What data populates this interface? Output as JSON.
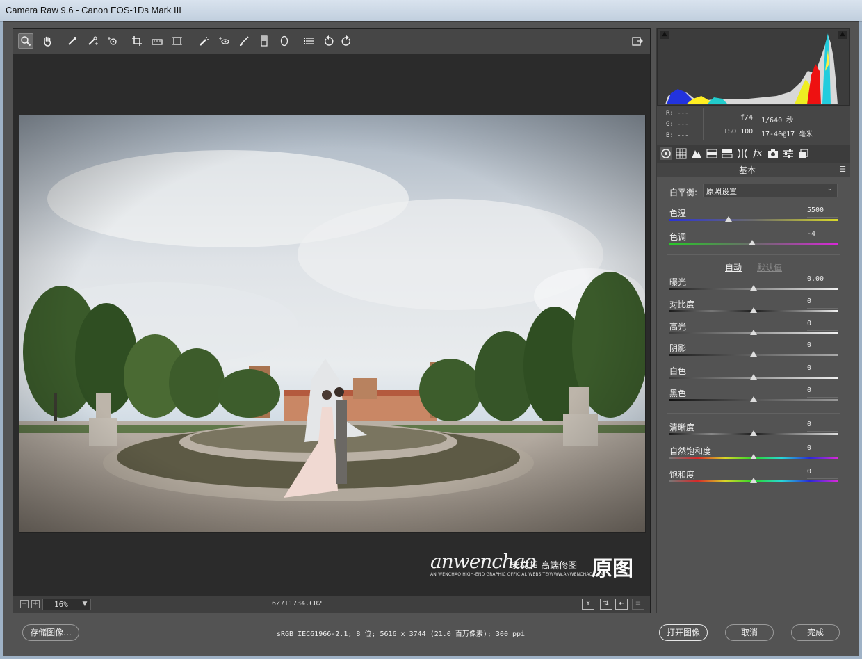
{
  "window": {
    "title": "Camera Raw 9.6 -  Canon EOS-1Ds Mark III"
  },
  "toolbar": {
    "tools": [
      "zoom-tool",
      "hand-tool",
      "white-balance-tool",
      "color-sampler-tool",
      "targeted-adjustment-tool",
      "crop-tool",
      "straighten-tool",
      "transform-tool",
      "spot-removal-tool",
      "red-eye-tool",
      "adjustment-brush",
      "graduated-filter",
      "radial-filter",
      "preferences",
      "rotate-ccw",
      "rotate-cw"
    ],
    "active_tool": "zoom-tool"
  },
  "histogram": {
    "rgb": {
      "r": "R: ---",
      "g": "G: ---",
      "b": "B: ---"
    },
    "aperture": "f/4",
    "shutter": "1/640 秒",
    "iso": "ISO 100",
    "lens": "17-40@17 毫米"
  },
  "panel": {
    "section_title": "基本",
    "white_balance": {
      "label": "白平衡:",
      "value": "原照设置"
    },
    "auto_label": "自动",
    "default_label": "默认值",
    "sliders": [
      {
        "label": "色温",
        "value": "5500",
        "level": 0.35
      },
      {
        "label": "色调",
        "value": "-4",
        "level": 0.49
      },
      {
        "label": "曝光",
        "value": "0.00",
        "level": 0.5
      },
      {
        "label": "对比度",
        "value": "0",
        "level": 0.5
      },
      {
        "label": "高光",
        "value": "0",
        "level": 0.5
      },
      {
        "label": "阴影",
        "value": "0",
        "level": 0.5
      },
      {
        "label": "白色",
        "value": "0",
        "level": 0.5
      },
      {
        "label": "黑色",
        "value": "0",
        "level": 0.5
      },
      {
        "label": "清晰度",
        "value": "0",
        "level": 0.5
      },
      {
        "label": "自然饱和度",
        "value": "0",
        "level": 0.5
      },
      {
        "label": "饱和度",
        "value": "0",
        "level": 0.5
      }
    ]
  },
  "preview": {
    "zoom": "16%",
    "filename": "6Z7T1734.CR2",
    "watermark": {
      "script": "anwenchao",
      "cn": "安文超 高端修图",
      "small": "AN WENCHAO HIGH-END GRAPHIC OFFICIAL WEBSITE/WWW.ANWENCHAO.COM",
      "tag": "原图"
    }
  },
  "footer": {
    "save_label": "存储图像...",
    "workflow": "sRGB IEC61966-2.1; 8 位; 5616 x 3744 (21.0 百万像素); 300 ppi",
    "open_label": "打开图像",
    "cancel_label": "取消",
    "done_label": "完成"
  },
  "colors": {
    "panel": "#535353",
    "dark": "#2b2b2b"
  }
}
